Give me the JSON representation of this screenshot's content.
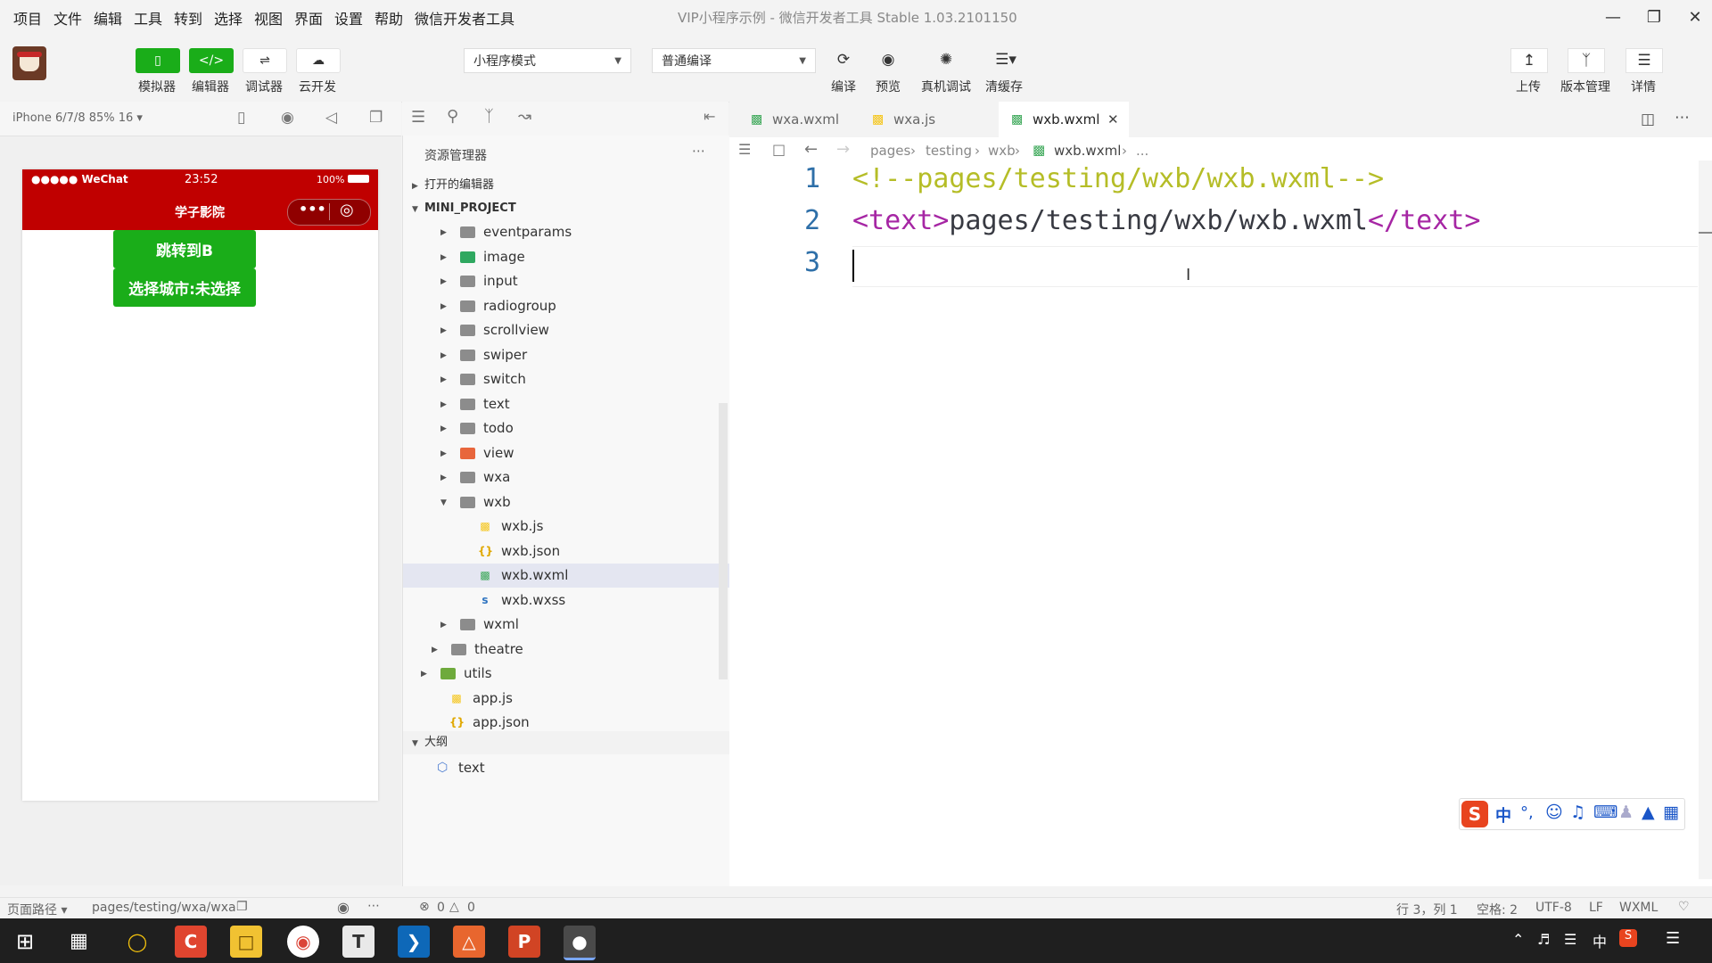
{
  "menu": [
    "项目",
    "文件",
    "编辑",
    "工具",
    "转到",
    "选择",
    "视图",
    "界面",
    "设置",
    "帮助",
    "微信开发者工具"
  ],
  "window_title": "VIP小程序示例 - 微信开发者工具 Stable 1.03.2101150",
  "toolbar": {
    "simulator_label": "模拟器",
    "editor_label": "编辑器",
    "debugger_label": "调试器",
    "cloud_label": "云开发",
    "mode_select": "小程序模式",
    "compile_select": "普通编译",
    "compile_label": "编译",
    "preview_label": "预览",
    "remote_debug_label": "真机调试",
    "clear_cache_label": "清缓存",
    "upload_label": "上传",
    "version_label": "版本管理",
    "details_label": "详情"
  },
  "simulator": {
    "device": "iPhone 6/7/8 85% 16 ▾",
    "status_carrier": "●●●●● WeChat",
    "status_time": "23:52",
    "status_battery": "100%",
    "nav_title": "学子影院",
    "button_jump": "跳转到B",
    "button_city": "选择城市:未选择"
  },
  "explorer": {
    "title": "资源管理器",
    "open_editors": "打开的编辑器",
    "project": "MINI_PROJECT",
    "items": [
      {
        "name": "eventparams",
        "type": "folder",
        "indent": 1
      },
      {
        "name": "image",
        "type": "folder-image",
        "indent": 1
      },
      {
        "name": "input",
        "type": "folder",
        "indent": 1
      },
      {
        "name": "radiogroup",
        "type": "folder",
        "indent": 1
      },
      {
        "name": "scrollview",
        "type": "folder",
        "indent": 1
      },
      {
        "name": "swiper",
        "type": "folder",
        "indent": 1
      },
      {
        "name": "switch",
        "type": "folder",
        "indent": 1
      },
      {
        "name": "text",
        "type": "folder",
        "indent": 1
      },
      {
        "name": "todo",
        "type": "folder",
        "indent": 1
      },
      {
        "name": "view",
        "type": "folder-view",
        "indent": 1
      },
      {
        "name": "wxa",
        "type": "folder",
        "indent": 1
      },
      {
        "name": "wxb",
        "type": "folder-open",
        "indent": 1
      },
      {
        "name": "wxb.js",
        "type": "js",
        "indent": 2
      },
      {
        "name": "wxb.json",
        "type": "json",
        "indent": 2
      },
      {
        "name": "wxb.wxml",
        "type": "wxml",
        "indent": 2
      },
      {
        "name": "wxb.wxss",
        "type": "wxss",
        "indent": 2
      },
      {
        "name": "wxml",
        "type": "folder",
        "indent": 1
      },
      {
        "name": "theatre",
        "type": "folder",
        "indent": 0
      },
      {
        "name": "utils",
        "type": "folder-utils",
        "indent": -1
      },
      {
        "name": "app.js",
        "type": "js",
        "indent": -1
      },
      {
        "name": "app.json",
        "type": "json",
        "indent": -1
      }
    ],
    "outline_title": "大纲",
    "outline_item": "text"
  },
  "tabs": [
    {
      "label": "wxa.wxml",
      "icon": "wxml"
    },
    {
      "label": "wxa.js",
      "icon": "js"
    },
    {
      "label": "wxb.wxml",
      "icon": "wxml"
    }
  ],
  "breadcrumb": [
    "pages",
    "testing",
    "wxb",
    "wxb.wxml",
    "..."
  ],
  "code_lines": [
    {
      "n": "1",
      "parts": [
        {
          "t": "<!--pages/testing/wxb/wxb.wxml-->",
          "c": "#b5bd27"
        }
      ]
    },
    {
      "n": "2",
      "parts": [
        {
          "t": "<text>",
          "c": "#a626a4"
        },
        {
          "t": "pages/testing/wxb/wxb.wxml",
          "c": "#383a42"
        },
        {
          "t": "</text>",
          "c": "#a626a4"
        }
      ]
    },
    {
      "n": "3",
      "parts": []
    }
  ],
  "statusbar": {
    "page_path_label": "页面路径 ▾",
    "page_path": "pages/testing/wxa/wxa",
    "errors": "0",
    "warnings": "0",
    "cursor": "行 3，列 1",
    "indent": "空格: 2",
    "encoding": "UTF-8",
    "eol": "LF",
    "language": "WXML"
  },
  "ime": {
    "lang": "中"
  },
  "tray": {
    "ime": "中"
  }
}
